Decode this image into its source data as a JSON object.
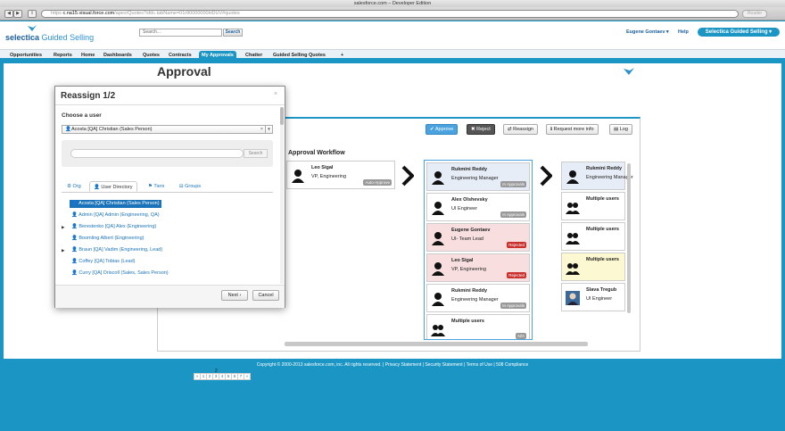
{
  "browser": {
    "title": "salesforce.com – Developer Edition",
    "url_prefix": "https",
    "url_host": "c.na15.visual.force.com",
    "url_path": "/apex/Quotes?sfdc.tabName=01r80000000HDUV#quotes",
    "reader": "Reader"
  },
  "header": {
    "logo_brand": "selectica",
    "logo_product": "Guided Selling",
    "search_placeholder": "Search...",
    "search_button": "Search",
    "user": "Eugene Gontaev",
    "help": "Help",
    "app_menu": "Selectica Guided Selling"
  },
  "tabs": [
    "Opportunities",
    "Reports",
    "Home",
    "Dashboards",
    "Quotes",
    "Contracts",
    "My Approvals",
    "Chatter",
    "Guided Selling Quotes",
    "+"
  ],
  "page": {
    "title": "Approval",
    "actions": {
      "approve": "Approve",
      "reject": "Reject",
      "reassign": "Reassign",
      "request_info": "Request more info",
      "log": "Log"
    },
    "workflow_title": "Approval Workflow",
    "first_card": {
      "name": "Leo Sigal",
      "role": "VP, Engineering",
      "badge": "Auto-Approve"
    },
    "middle_cards": [
      {
        "name": "Rukmini Reddy",
        "role": "Engineering Manager",
        "badge": "In Approvals"
      },
      {
        "name": "Alex Olshevsky",
        "role": "UI Engineer",
        "badge": "In Approvals"
      },
      {
        "name": "Eugene Gontaev",
        "role": "UI- Team Lead",
        "badge": "Rejected"
      },
      {
        "name": "Leo Sigal",
        "role": "VP, Engineering",
        "badge": "Rejected"
      },
      {
        "name": "Rukmini Reddy",
        "role": "Engineering Manager",
        "badge": "In Approvals"
      },
      {
        "name": "Multiple users",
        "role": "",
        "badge": "N/A"
      }
    ],
    "right_cards": [
      {
        "name": "Rukmini Reddy",
        "role": "Engineering Manager"
      },
      {
        "name": "Multiple users",
        "role": ""
      },
      {
        "name": "Multiple users",
        "role": ""
      },
      {
        "name": "Multiple users",
        "role": ""
      },
      {
        "name": "Slava Tregub",
        "role": "UI Engineer"
      }
    ],
    "pager": [
      "«",
      "1",
      "2",
      "3",
      "4",
      "5",
      "6",
      "7",
      "»"
    ],
    "pager_partial": "2"
  },
  "modal": {
    "title": "Reassign 1/2",
    "close": "×",
    "choose_label": "Choose a user",
    "selected_user": "Acosta [QA] Christian (Sales Person)",
    "search_button": "Search",
    "tabs": [
      "Org",
      "User Directory",
      "Tiers",
      "Groups"
    ],
    "users": [
      {
        "label": "Acosta [QA] Christian (Sales Person)",
        "expand": false,
        "selected": true
      },
      {
        "label": "Admin [QA] Admin (Engineering, QA)",
        "expand": false,
        "selected": false
      },
      {
        "label": "Berestenko [QA] Alex (Engineering)",
        "expand": true,
        "selected": false
      },
      {
        "label": "Boomling Albert (Engineering)",
        "expand": false,
        "selected": false
      },
      {
        "label": "Braun [QA] Vadim (Engineering, Lead)",
        "expand": true,
        "selected": false
      },
      {
        "label": "Coffey [QA] Tobias (Lead)",
        "expand": false,
        "selected": false
      },
      {
        "label": "Curry [QA] Driscoll (Sales, Sales Person)",
        "expand": false,
        "selected": false
      }
    ],
    "next": "Next",
    "cancel": "Cancel"
  },
  "footer": {
    "copyright": "Copyright © 2000-2013 salesforce.com, inc. All rights reserved.",
    "links": [
      "Privacy Statement",
      "Security Statement",
      "Terms of Use",
      "508 Compliance"
    ]
  }
}
